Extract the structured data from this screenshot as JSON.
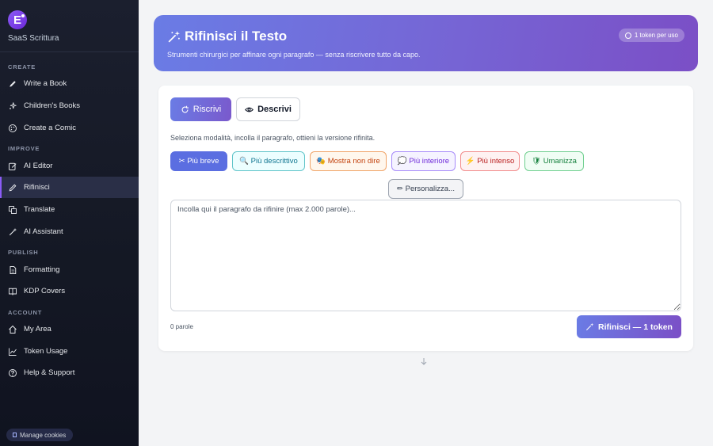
{
  "sidebar": {
    "brand_letter": "E",
    "brand_name": "SaaS Scrittura",
    "sections": {
      "create": "CREATE",
      "improve": "IMPROVE",
      "publish": "PUBLISH",
      "account": "ACCOUNT"
    },
    "items": {
      "write_book": "Write a Book",
      "childrens_books": "Children's Books",
      "create_comic": "Create a Comic",
      "ai_editor": "AI Editor",
      "rifinisci": "Rifinisci",
      "translate": "Translate",
      "ai_assistant": "AI Assistant",
      "formatting": "Formatting",
      "kdp_covers": "KDP Covers",
      "my_area": "My Area",
      "token_usage": "Token Usage",
      "help_support": "Help & Support"
    },
    "active_item": "Rifinisci",
    "cookie_label": "Manage cookies"
  },
  "hero": {
    "title": "Rifinisci il Testo",
    "subtitle": "Strumenti chirurgici per affinare ogni paragrafo — senza riscrivere tutto da capo.",
    "token_badge": "1 token per uso"
  },
  "tabs": {
    "rewrite": "Riscrivi",
    "describe": "Descrivi",
    "active": "Riscrivi"
  },
  "hint": "Seleziona modalità, incolla il paragrafo, ottieni la versione rifinita.",
  "modes": {
    "shorter": "✂ Più breve",
    "descriptive": "🔍 Più descrittivo",
    "show_dont_tell": "🎭 Mostra non dire",
    "interior": "💭 Più interiore",
    "intense": "⚡ Più intenso",
    "humanize": "🛡 Umanizza",
    "customize": "✏ Personalizza...",
    "selected": "Più breve"
  },
  "editor": {
    "placeholder": "Incolla qui il paragrafo da rifinire (max 2.000 parole)...",
    "value": ""
  },
  "word_count": "0 parole",
  "submit_label": "Rifinisci — 1 token",
  "colors": {
    "accent": "#6a7ce5",
    "accent_purple": "#7b4fc6",
    "sidebar_bg": "#1b1f2e",
    "active_border": "#8b5cf6"
  }
}
